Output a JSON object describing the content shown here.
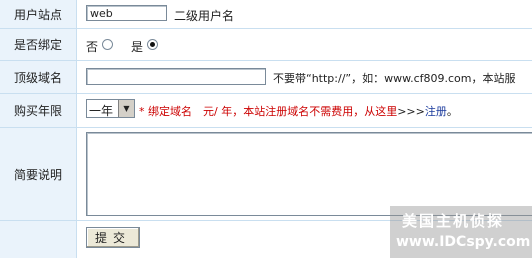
{
  "form": {
    "site": {
      "label": "用户站点",
      "value": "web",
      "suffix": "二级用户名"
    },
    "bind": {
      "label": "是否绑定",
      "opt_no": "否",
      "opt_yes": "是",
      "selected": "是"
    },
    "domain": {
      "label": "顶级域名",
      "value": "",
      "hint": "不要带“http://”，如：www.cf809.com，本站服"
    },
    "years": {
      "label": "购买年限",
      "selected": "一年",
      "notice_a": "* 绑定域名　元/ 年，本站注册域名不需费用，从这里",
      "notice_arrows": ">>>",
      "register_link": "注册",
      "notice_end": "。"
    },
    "desc": {
      "label": "简要说明",
      "value": ""
    },
    "submit": {
      "label": "提交"
    }
  },
  "watermark": {
    "line1": "美国主机侦探",
    "line2": "www.IDCspy.com"
  },
  "colors": {
    "label_bg": "#eaf3fb",
    "border": "#c9dff0",
    "notice": "#cc0000"
  }
}
